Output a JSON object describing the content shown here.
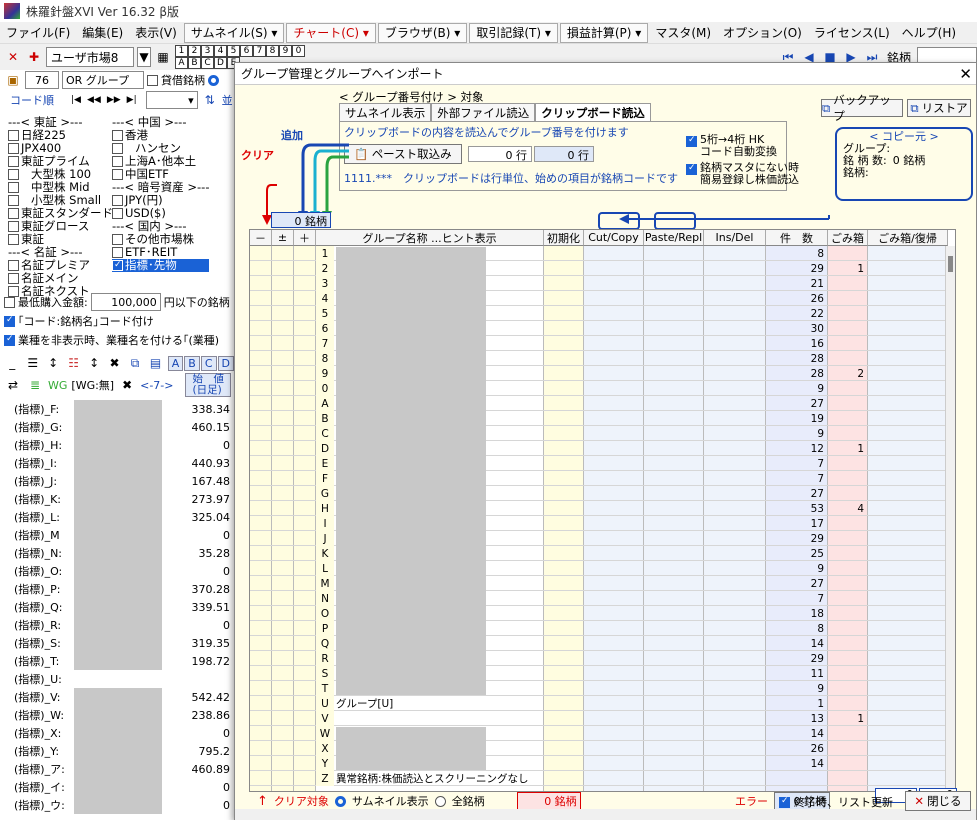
{
  "app": {
    "title": "株羅針盤XVI Ver 16.32 β版"
  },
  "menu": [
    {
      "label": "ファイル(F)",
      "button": false
    },
    {
      "label": "編集(E)",
      "button": false
    },
    {
      "label": "表示(V)",
      "button": false
    },
    {
      "label": "サムネイル(S) ▾",
      "button": true
    },
    {
      "label": "チャート(C) ▾",
      "button": true,
      "accent": true
    },
    {
      "label": "ブラウザ(B) ▾",
      "button": true
    },
    {
      "label": "取引記録(T) ▾",
      "button": true
    },
    {
      "label": "損益計算(P) ▾",
      "button": true
    },
    {
      "label": "マスタ(M)",
      "button": false
    },
    {
      "label": "オプション(O)",
      "button": false
    },
    {
      "label": "ライセンス(L)",
      "button": false
    },
    {
      "label": "ヘルプ(H)",
      "button": false
    }
  ],
  "toolbar": {
    "market_select": "ユーザ市場8",
    "numbers": [
      "1",
      "2",
      "3",
      "4",
      "5",
      "6",
      "7",
      "8",
      "9",
      "0"
    ],
    "letters": [
      "A",
      "B",
      "C",
      "D",
      "E"
    ],
    "brand_label": "銘柄"
  },
  "left": {
    "group_num": "76",
    "group_mode": "OR グループ",
    "lending_label": "貸借銘柄",
    "code_order": "コード順",
    "nav_glyphs": [
      "|◀",
      "◀◀",
      "▶▶",
      "▶|"
    ],
    "sort_label": "並",
    "col1": {
      "header1": "---< 東証 >---",
      "items1": [
        "日経225",
        "JPX400",
        "東証プライム",
        "大型株 100",
        "中型株 Mid",
        "小型株 Small",
        "東証スタンダード",
        "東証グロース",
        "東証"
      ],
      "header2": "---< 名証 >---",
      "items2": [
        "名証プレミア",
        "名証メイン",
        "名証ネクスト"
      ]
    },
    "col2": {
      "header1": "---< 中国 >---",
      "items1": [
        "香港",
        "ハンセン",
        "上海A･他本土",
        "中国ETF"
      ],
      "header2": "---< 暗号資産 >---",
      "items2": [
        "JPY(円)",
        "USD($)"
      ],
      "header3": "---< 国内 >---",
      "items3": [
        "その他市場株",
        "ETF･REIT",
        "指標･先物"
      ]
    },
    "min_price_label": "最低購入金額:",
    "min_price_value": "100,000",
    "min_price_suffix": "円以下の銘柄",
    "opt1": "｢コード:銘柄名｣コード付け",
    "opt2": "業種を非表示時、業種名を付ける｢(業種)",
    "letter_tabs": [
      "A",
      "B",
      "C",
      "D"
    ],
    "col_label": "始　値\n(日足)",
    "wg_label": "WG",
    "wg_state": "[WG:無]",
    "arrow_label": "<-7->",
    "rows": [
      {
        "name": "(指標)_F:",
        "value": "338.34"
      },
      {
        "name": "(指標)_G:",
        "value": "460.15"
      },
      {
        "name": "(指標)_H:",
        "value": "0"
      },
      {
        "name": "(指標)_I:",
        "value": "440.93"
      },
      {
        "name": "(指標)_J:",
        "value": "167.48"
      },
      {
        "name": "(指標)_K:",
        "value": "273.97"
      },
      {
        "name": "(指標)_L:",
        "value": "325.04"
      },
      {
        "name": "(指標)_M",
        "value": "0"
      },
      {
        "name": "(指標)_N:",
        "value": "35.28"
      },
      {
        "name": "(指標)_O:",
        "value": "0"
      },
      {
        "name": "(指標)_P:",
        "value": "370.28"
      },
      {
        "name": "(指標)_Q:",
        "value": "339.51"
      },
      {
        "name": "(指標)_R:",
        "value": "0"
      },
      {
        "name": "(指標)_S:",
        "value": "319.35"
      },
      {
        "name": "(指標)_T:",
        "value": "198.72"
      },
      {
        "name": "(指標)_U:",
        "value": ""
      },
      {
        "name": "(指標)_V:",
        "value": "542.42"
      },
      {
        "name": "(指標)_W:",
        "value": "238.86"
      },
      {
        "name": "(指標)_X:",
        "value": "0"
      },
      {
        "name": "(指標)_Y:",
        "value": "795.2"
      },
      {
        "name": "(指標)_ア:",
        "value": "460.89"
      },
      {
        "name": "(指標)_イ:",
        "value": "0"
      },
      {
        "name": "(指標)_ウ:",
        "value": "0"
      }
    ]
  },
  "dialog": {
    "title": "グループ管理とグループへインポート",
    "section_label": "< グループ番号付け > 対象",
    "tabs": [
      "サムネイル表示",
      "外部ファイル読込",
      "クリップボード読込"
    ],
    "desc": "クリップボードの内容を読込んでグループ番号を付けます",
    "paste_button": "ペースト取込み",
    "rows_count1": "0 行",
    "rows_count2": "0 行",
    "hk_option": "5桁→4桁 HK\nコード自動変換",
    "master_option": "銘柄マスタにない時\n簡易登録し株価読込",
    "note": "1111.***　クリップボードは行単位、始めの項目が銘柄コードです",
    "add_label": "追加",
    "clear_label": "クリア",
    "brand_count": "0 銘柄",
    "backup_button": "バックアップ",
    "restore_button": "リストア",
    "copy_source": {
      "header": "< コピー元 >",
      "group_label": "グループ:",
      "count_label": "銘 柄 数:",
      "count_value": "0 銘柄",
      "brand_label": "銘柄:"
    },
    "columns": [
      "－",
      "±",
      "＋",
      "グループ名称 ...ヒント表示",
      "初期化",
      "Cut/Copy",
      "Paste/Repl",
      "Ins/Del",
      "件　数",
      "ごみ箱",
      "ごみ箱/復帰"
    ],
    "rows": [
      {
        "label": "1",
        "name": "",
        "count": "8",
        "trash": ""
      },
      {
        "label": "2",
        "name": "",
        "count": "29",
        "trash": "1"
      },
      {
        "label": "3",
        "name": "",
        "count": "21",
        "trash": ""
      },
      {
        "label": "4",
        "name": "",
        "count": "26",
        "trash": ""
      },
      {
        "label": "5",
        "name": "",
        "count": "22",
        "trash": ""
      },
      {
        "label": "6",
        "name": "",
        "count": "30",
        "trash": ""
      },
      {
        "label": "7",
        "name": "",
        "count": "16",
        "trash": ""
      },
      {
        "label": "8",
        "name": "",
        "count": "28",
        "trash": ""
      },
      {
        "label": "9",
        "name": "",
        "count": "28",
        "trash": "2"
      },
      {
        "label": "0",
        "name": "",
        "count": "9",
        "trash": ""
      },
      {
        "label": "A",
        "name": "",
        "count": "27",
        "trash": ""
      },
      {
        "label": "B",
        "name": "",
        "count": "19",
        "trash": ""
      },
      {
        "label": "C",
        "name": "",
        "count": "9",
        "trash": ""
      },
      {
        "label": "D",
        "name": "",
        "count": "12",
        "trash": "1"
      },
      {
        "label": "E",
        "name": "",
        "count": "7",
        "trash": ""
      },
      {
        "label": "F",
        "name": "",
        "count": "7",
        "trash": ""
      },
      {
        "label": "G",
        "name": "",
        "count": "27",
        "trash": ""
      },
      {
        "label": "H",
        "name": "",
        "count": "53",
        "trash": "4"
      },
      {
        "label": "I",
        "name": "",
        "count": "17",
        "trash": ""
      },
      {
        "label": "J",
        "name": "",
        "count": "29",
        "trash": ""
      },
      {
        "label": "K",
        "name": "",
        "count": "25",
        "trash": ""
      },
      {
        "label": "L",
        "name": "",
        "count": "9",
        "trash": ""
      },
      {
        "label": "M",
        "name": "",
        "count": "27",
        "trash": ""
      },
      {
        "label": "N",
        "name": "",
        "count": "7",
        "trash": ""
      },
      {
        "label": "O",
        "name": "",
        "count": "18",
        "trash": ""
      },
      {
        "label": "P",
        "name": "",
        "count": "8",
        "trash": ""
      },
      {
        "label": "Q",
        "name": "",
        "count": "14",
        "trash": ""
      },
      {
        "label": "R",
        "name": "",
        "count": "29",
        "trash": ""
      },
      {
        "label": "S",
        "name": "",
        "count": "11",
        "trash": ""
      },
      {
        "label": "T",
        "name": "",
        "count": "9",
        "trash": ""
      },
      {
        "label": "U",
        "name": "グループ[U]",
        "count": "1",
        "trash": ""
      },
      {
        "label": "V",
        "name": "",
        "count": "13",
        "trash": "1"
      },
      {
        "label": "W",
        "name": "",
        "count": "14",
        "trash": ""
      },
      {
        "label": "X",
        "name": "",
        "count": "26",
        "trash": ""
      },
      {
        "label": "Y",
        "name": "",
        "count": "14",
        "trash": ""
      },
      {
        "label": "Z",
        "name": "異常銘柄:株価読込とスクリーニングなし",
        "count": "",
        "trash": ""
      }
    ],
    "clear_target": "クリア対象",
    "radio1": "サムネイル表示",
    "radio2": "全銘柄",
    "target_count": "0 銘柄",
    "error_label": "エラー",
    "error_count": "0 銘柄",
    "sum1": "0",
    "sum2": "0",
    "update_option": "終了時、リスト更新",
    "close_button": "閉じる"
  }
}
